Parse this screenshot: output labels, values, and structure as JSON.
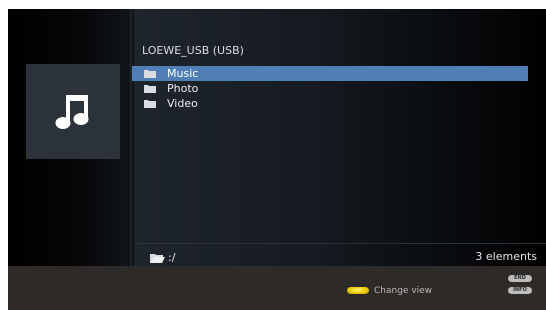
{
  "browser": {
    "title": "LOEWE_USB (USB)",
    "items": [
      {
        "label": "Music",
        "selected": true
      },
      {
        "label": "Photo",
        "selected": false
      },
      {
        "label": "Video",
        "selected": false
      }
    ],
    "path": ":/",
    "count": "3 elements"
  },
  "preview": {
    "icon": "music-note-icon"
  },
  "footer": {
    "change_view_label": "Change view",
    "change_view_key": "yellow-key",
    "end_button": "END",
    "info_button": "INFO"
  },
  "colors": {
    "selection": "#4f7fb4",
    "footer_bg": "#2e2a27",
    "yellow_key": "#e8c800"
  }
}
